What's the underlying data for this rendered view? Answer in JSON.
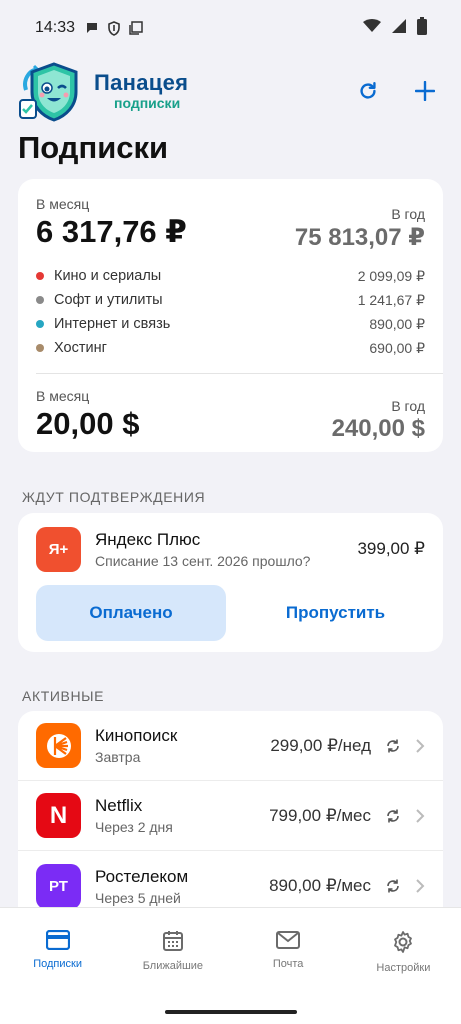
{
  "status_bar": {
    "time": "14:33"
  },
  "header": {
    "logo_line1": "Панацея",
    "logo_line2": "подписки",
    "title": "Подписки"
  },
  "summary": {
    "rub": {
      "month_label": "В месяц",
      "month_value": "6 317,76 ₽",
      "year_label": "В год",
      "year_value": "75 813,07 ₽"
    },
    "categories": [
      {
        "name": "Кино и сериалы",
        "amount": "2 099,09 ₽",
        "color": "#e53935"
      },
      {
        "name": "Софт и утилиты",
        "amount": "1 241,67 ₽",
        "color": "#8a8a8a"
      },
      {
        "name": "Интернет и связь",
        "amount": "890,00 ₽",
        "color": "#26a6c2"
      },
      {
        "name": "Хостинг",
        "amount": "690,00 ₽",
        "color": "#a88b6a"
      }
    ],
    "usd": {
      "month_label": "В месяц",
      "month_value": "20,00 $",
      "year_label": "В год",
      "year_value": "240,00 $"
    }
  },
  "pending": {
    "section_label": "ЖДУТ ПОДТВЕРЖДЕНИЯ",
    "item": {
      "logo_text": "Я+",
      "logo_color": "#f0502f",
      "name": "Яндекс Плюс",
      "subtitle": "Списание 13 сент. 2026 прошло?",
      "price": "399,00 ₽"
    },
    "paid_label": "Оплачено",
    "skip_label": "Пропустить"
  },
  "active": {
    "section_label": "АКТИВНЫЕ",
    "items": [
      {
        "name": "Кинопоиск",
        "subtitle": "Завтра",
        "price": "299,00 ₽/нед",
        "logo_color": "#ff6a00",
        "logo_text": ""
      },
      {
        "name": "Netflix",
        "subtitle": "Через 2 дня",
        "price": "799,00 ₽/мес",
        "logo_color": "#e50914",
        "logo_text": "N"
      },
      {
        "name": "Ростелеком",
        "subtitle": "Через 5 дней",
        "price": "890,00 ₽/мес",
        "logo_color": "#7b2cf5",
        "logo_text": "РТ"
      }
    ]
  },
  "nav": {
    "items": [
      {
        "label": "Подписки",
        "icon": "card-icon",
        "active": true
      },
      {
        "label": "Ближайшие",
        "icon": "calendar-icon",
        "active": false
      },
      {
        "label": "Почта",
        "icon": "mail-icon",
        "active": false
      },
      {
        "label": "Настройки",
        "icon": "gear-icon",
        "active": false
      }
    ]
  },
  "colors": {
    "accent": "#0a6bd1",
    "accent_soft": "#d6e7fb",
    "background": "#f2f2f7"
  }
}
